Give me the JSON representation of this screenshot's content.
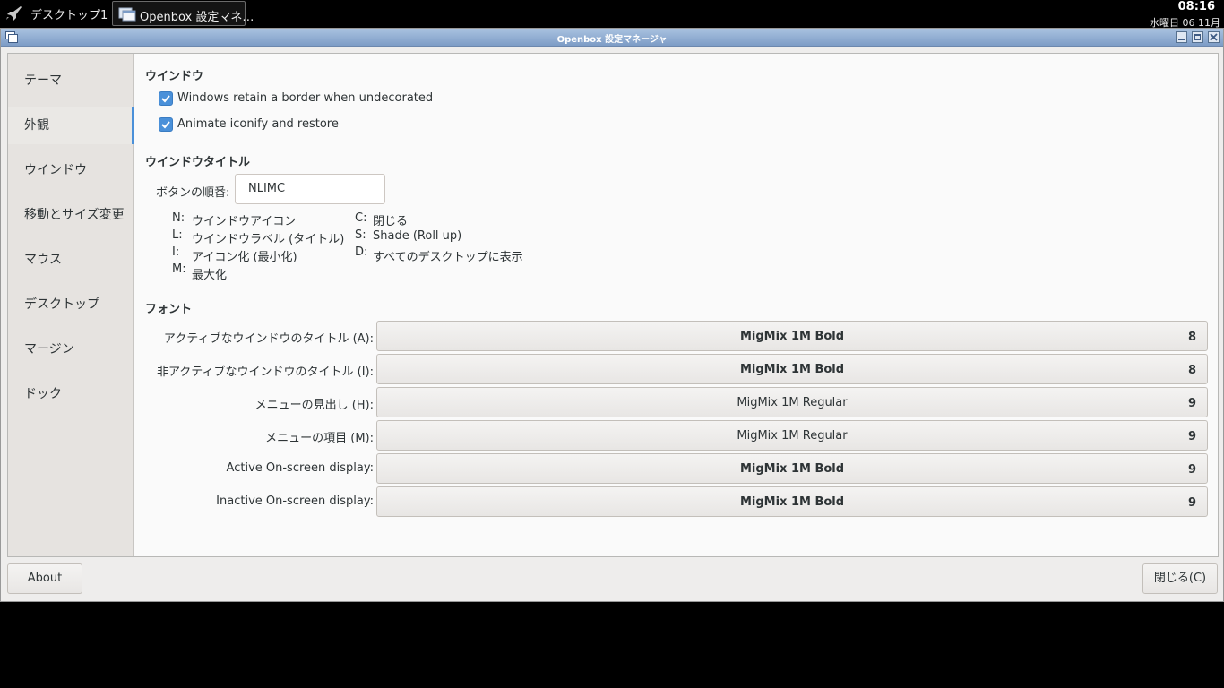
{
  "taskbar": {
    "desktop_label": "デスクトップ1",
    "task_label": "Openbox 設定マネ…",
    "clock_time": "08:16",
    "clock_date": "水曜日 06 11月"
  },
  "window": {
    "title": "Openbox 設定マネージャ"
  },
  "sidebar": {
    "items": [
      {
        "label": "テーマ"
      },
      {
        "label": "外観"
      },
      {
        "label": "ウインドウ"
      },
      {
        "label": "移動とサイズ変更"
      },
      {
        "label": "マウス"
      },
      {
        "label": "デスクトップ"
      },
      {
        "label": "マージン"
      },
      {
        "label": "ドック"
      }
    ],
    "active_index": 1
  },
  "window_section": {
    "title": "ウインドウ",
    "options": [
      {
        "label": "Windows retain a border when undecorated",
        "checked": true
      },
      {
        "label": "Animate iconify and restore",
        "checked": true
      }
    ]
  },
  "title_section": {
    "title": "ウインドウタイトル",
    "order_label": "ボタンの順番:",
    "order_value": "NLIMC",
    "legend_left": [
      {
        "key": "N:",
        "value": "ウインドウアイコン"
      },
      {
        "key": "L:",
        "value": "ウインドウラベル (タイトル)"
      },
      {
        "key": "I:",
        "value": "アイコン化 (最小化)"
      },
      {
        "key": "M:",
        "value": "最大化"
      }
    ],
    "legend_right": [
      {
        "key": "C:",
        "value": "閉じる"
      },
      {
        "key": "S:",
        "value": "Shade (Roll up)"
      },
      {
        "key": "D:",
        "value": "すべてのデスクトップに表示"
      }
    ]
  },
  "font_section": {
    "title": "フォント",
    "rows": [
      {
        "label": "アクティブなウインドウのタイトル (A):",
        "font": "MigMix 1M Bold",
        "size": "8",
        "bold": true
      },
      {
        "label": "非アクティブなウインドウのタイトル (I):",
        "font": "MigMix 1M Bold",
        "size": "8",
        "bold": true
      },
      {
        "label": "メニューの見出し (H):",
        "font": "MigMix 1M Regular",
        "size": "9",
        "bold": false
      },
      {
        "label": "メニューの項目 (M):",
        "font": "MigMix 1M Regular",
        "size": "9",
        "bold": false
      },
      {
        "label": "Active On-screen display:",
        "font": "MigMix 1M Bold",
        "size": "9",
        "bold": true
      },
      {
        "label": "Inactive On-screen display:",
        "font": "MigMix 1M Bold",
        "size": "9",
        "bold": true
      }
    ]
  },
  "footer": {
    "about_label": "About",
    "close_label": "閉じる(C)"
  },
  "colors": {
    "accent": "#4a90d9",
    "titlebar": "#7d9cc6",
    "sidebar_bg": "#e6e3e0"
  }
}
